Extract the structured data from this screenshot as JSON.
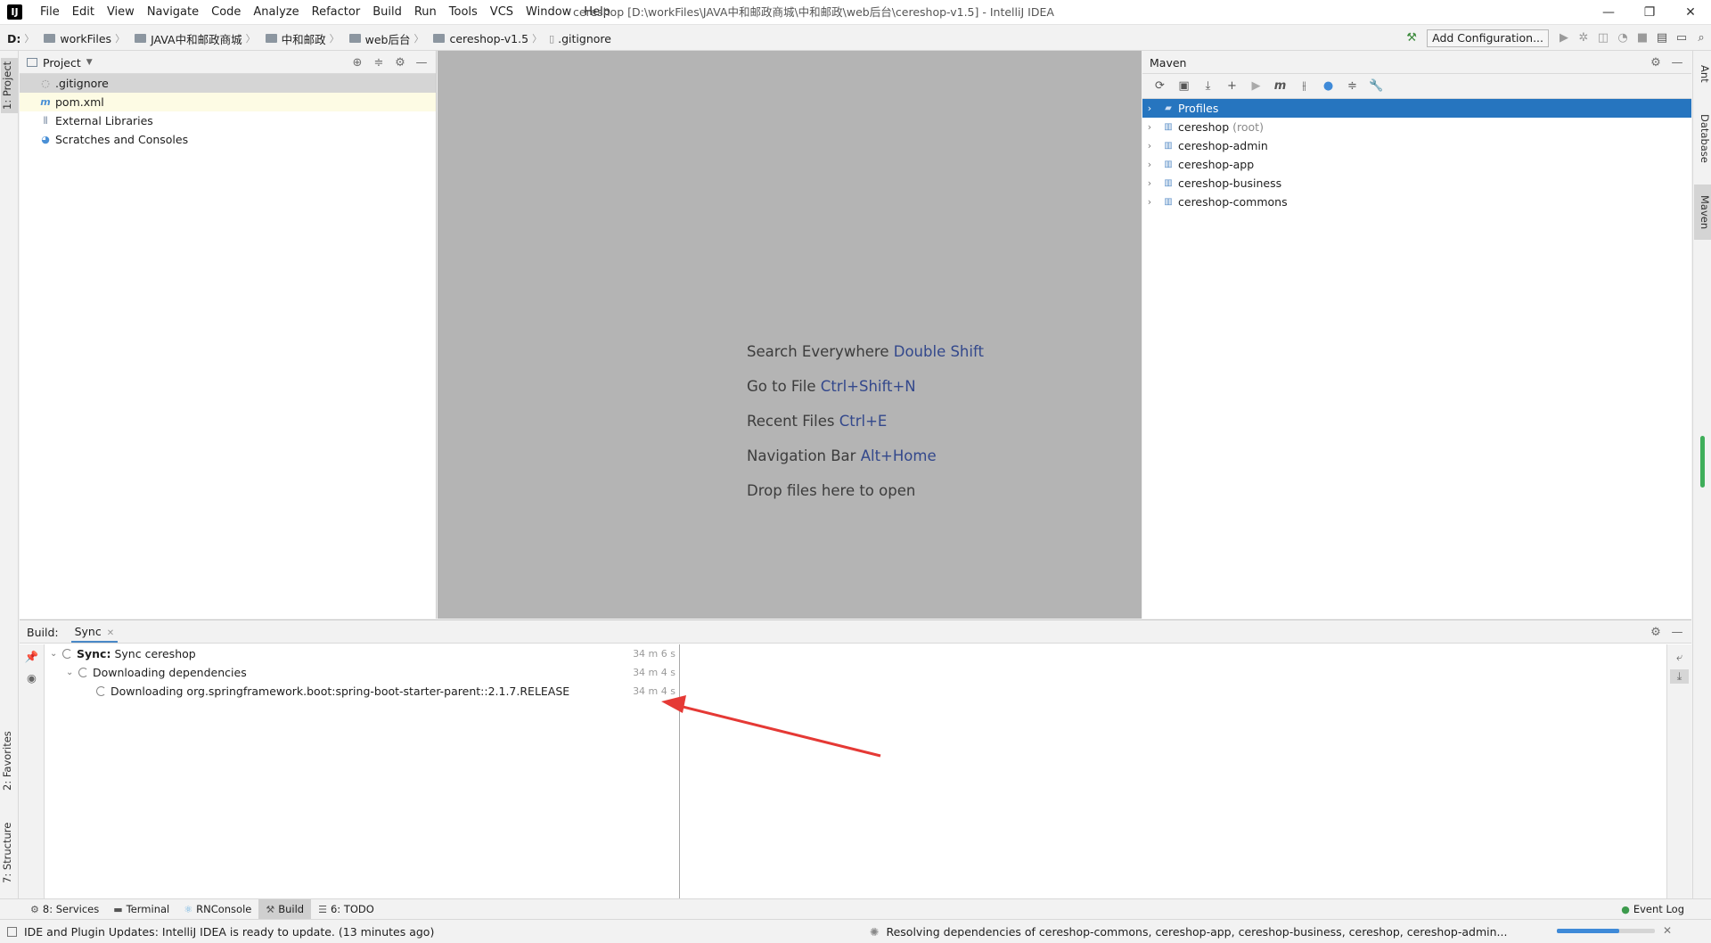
{
  "app": {
    "logo": "IJ",
    "menu": [
      "File",
      "Edit",
      "View",
      "Navigate",
      "Code",
      "Analyze",
      "Refactor",
      "Build",
      "Run",
      "Tools",
      "VCS",
      "Window",
      "Help"
    ],
    "window_title": "cereshop [D:\\workFiles\\JAVA中和邮政商城\\中和邮政\\web后台\\cereshop-v1.5] - IntelliJ IDEA",
    "controls": {
      "minimize": "—",
      "restore": "❐",
      "close": "✕"
    }
  },
  "breadcrumb": [
    "D:",
    "workFiles",
    "JAVA中和邮政商城",
    "中和邮政",
    "web后台",
    "cereshop-v1.5",
    ".gitignore"
  ],
  "toolbar": {
    "add_configuration": "Add Configuration..."
  },
  "left_stripe": {
    "project": "1: Project",
    "favorites": "2: Favorites",
    "structure": "7: Structure"
  },
  "right_stripe": {
    "ant": "Ant",
    "database": "Database",
    "maven": "Maven"
  },
  "project_panel": {
    "title": "Project",
    "items": [
      {
        "label": ".gitignore",
        "icon": "gitignore-file-icon",
        "state": "selected"
      },
      {
        "label": "pom.xml",
        "icon": "maven-file-icon",
        "state": "highlighted"
      },
      {
        "label": "External Libraries",
        "icon": "libraries-icon",
        "state": "normal"
      },
      {
        "label": "Scratches and Consoles",
        "icon": "scratches-icon",
        "state": "normal"
      }
    ]
  },
  "editor_hints": [
    {
      "text": "Search Everywhere",
      "key": "Double Shift"
    },
    {
      "text": "Go to File",
      "key": "Ctrl+Shift+N"
    },
    {
      "text": "Recent Files",
      "key": "Ctrl+E"
    },
    {
      "text": "Navigation Bar",
      "key": "Alt+Home"
    },
    {
      "text": "Drop files here to open",
      "key": ""
    }
  ],
  "maven_panel": {
    "title": "Maven",
    "items": [
      {
        "label": "Profiles",
        "extra": "",
        "selected": true
      },
      {
        "label": "cereshop",
        "extra": "(root)",
        "selected": false
      },
      {
        "label": "cereshop-admin",
        "extra": "",
        "selected": false
      },
      {
        "label": "cereshop-app",
        "extra": "",
        "selected": false
      },
      {
        "label": "cereshop-business",
        "extra": "",
        "selected": false
      },
      {
        "label": "cereshop-commons",
        "extra": "",
        "selected": false
      }
    ]
  },
  "build_panel": {
    "label": "Build:",
    "tab": "Sync",
    "rows": [
      {
        "bold": "Sync:",
        "text": "Sync cereshop",
        "time": "34 m 6 s"
      },
      {
        "bold": "",
        "text": "Downloading dependencies",
        "time": "34 m 4 s"
      },
      {
        "bold": "",
        "text": "Downloading org.springframework.boot:spring-boot-starter-parent::2.1.7.RELEASE",
        "time": "34 m 4 s"
      }
    ]
  },
  "bottom_tabs": [
    {
      "label": "8: Services",
      "icon": "services-icon"
    },
    {
      "label": "Terminal",
      "icon": "terminal-icon"
    },
    {
      "label": "RNConsole",
      "icon": "rnconsole-icon"
    },
    {
      "label": "Build",
      "icon": "build-hammer-icon"
    },
    {
      "label": "6: TODO",
      "icon": "todo-icon"
    }
  ],
  "event_log": "Event Log",
  "status": {
    "left": "IDE and Plugin Updates: IntelliJ IDEA is ready to update. (13 minutes ago)",
    "right": "Resolving dependencies of cereshop-commons, cereshop-app, cereshop-business, cereshop, cereshop-admin...",
    "progress": 0.64
  },
  "colors": {
    "selection": "#2675bf",
    "hint_key": "#33488c",
    "annotation_arrow": "#e53935",
    "progress": "#3f8ad8"
  }
}
